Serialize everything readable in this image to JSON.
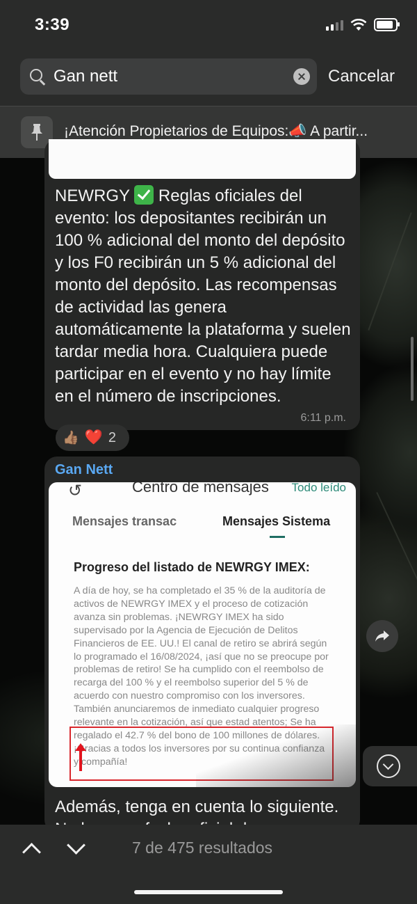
{
  "status_bar": {
    "time": "3:39"
  },
  "search": {
    "value": "Gan nett",
    "cancel_label": "Cancelar"
  },
  "pinned": {
    "text": "¡Atención Propietarios de Equipos:📣 A partir..."
  },
  "message1": {
    "prefix": "NEWRGY",
    "text": "Reglas oficiales del evento: los depositantes recibirán un 100 % adicional del monto del depósito y los F0 recibirán un 5 % adicional del monto del depósito. Las recompensas de actividad las genera automáticamente la plataforma y suelen tardar media hora. Cualquiera puede participar en el evento y no hay límite en el número de inscripciones.",
    "time": "6:11 p.m."
  },
  "reactions": {
    "thumb": "👍🏽",
    "heart": "❤️",
    "count": "2"
  },
  "message2": {
    "sender": "Gan Nett",
    "screenshot": {
      "back": "↺",
      "title": "Centro de mensajes",
      "action": "Todo leído",
      "tab1": "Mensajes transac",
      "tab2": "Mensajes Sistema",
      "heading": "Progreso del listado de NEWRGY IMEX:",
      "body": "A día de hoy, se ha completado el 35 % de la auditoría de activos de NEWRGY IMEX y el proceso de cotización avanza sin problemas. ¡NEWRGY IMEX ha sido supervisado por la Agencia de Ejecución de Delitos Financieros de EE. UU.! El canal de retiro se abrirá según lo programado el 16/08/2024, ¡así que no se preocupe por problemas de retiro! Se ha cumplido con el reembolso de recarga del 100 % y el reembolso superior del 5 % de acuerdo con nuestro compromiso con los inversores. También anunciaremos de inmediato cualquier progreso relevante en la cotización, así que estad atentos; Se ha regalado el 42.7 % del bono de 100 millones de dólares. ¡Gracias a todos los inversores por su continua confianza y compañía!"
    },
    "text": "Además, tenga en cuenta lo siguiente. No hay una fecha oficial de"
  },
  "bottom_bar": {
    "results": "7 de 475 resultados"
  }
}
